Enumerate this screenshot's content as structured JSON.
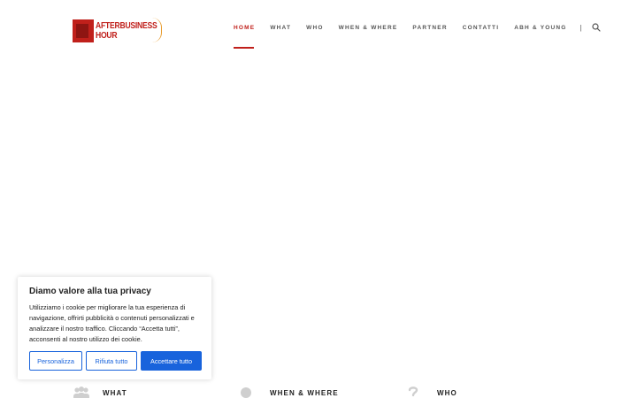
{
  "logo": {
    "line1": "AFTERBUSINESS",
    "line2": "HOUR"
  },
  "nav": {
    "items": [
      {
        "label": "HOME",
        "active": true
      },
      {
        "label": "WHAT",
        "active": false
      },
      {
        "label": "WHO",
        "active": false
      },
      {
        "label": "WHEN & WHERE",
        "active": false
      },
      {
        "label": "PARTNER",
        "active": false
      },
      {
        "label": "CONTATTI",
        "active": false
      },
      {
        "label": "ABH & YOUNG",
        "active": false
      }
    ],
    "separator": "|",
    "search_icon": "search-icon"
  },
  "cookie": {
    "title": "Diamo valore alla tua privacy",
    "text": "Utilizziamo i cookie per migliorare la tua esperienza di navigazione, offrirti pubblicità o contenuti personalizzati e analizzare il nostro traffico. Cliccando “Accetta tutti”, acconsenti al nostro utilizzo dei cookie.",
    "buttons": {
      "customize": "Personalizza",
      "reject": "Rifiuta tutto",
      "accept": "Accettare tutto"
    }
  },
  "features": [
    {
      "label": "WHAT",
      "icon": "people-icon"
    },
    {
      "label": "WHEN & WHERE",
      "icon": "location-icon"
    },
    {
      "label": "WHO",
      "icon": "question-icon"
    }
  ],
  "colors": {
    "accent": "#c0201b",
    "cookie_button": "#1863dc",
    "logo_arc": "#e89a2a"
  }
}
